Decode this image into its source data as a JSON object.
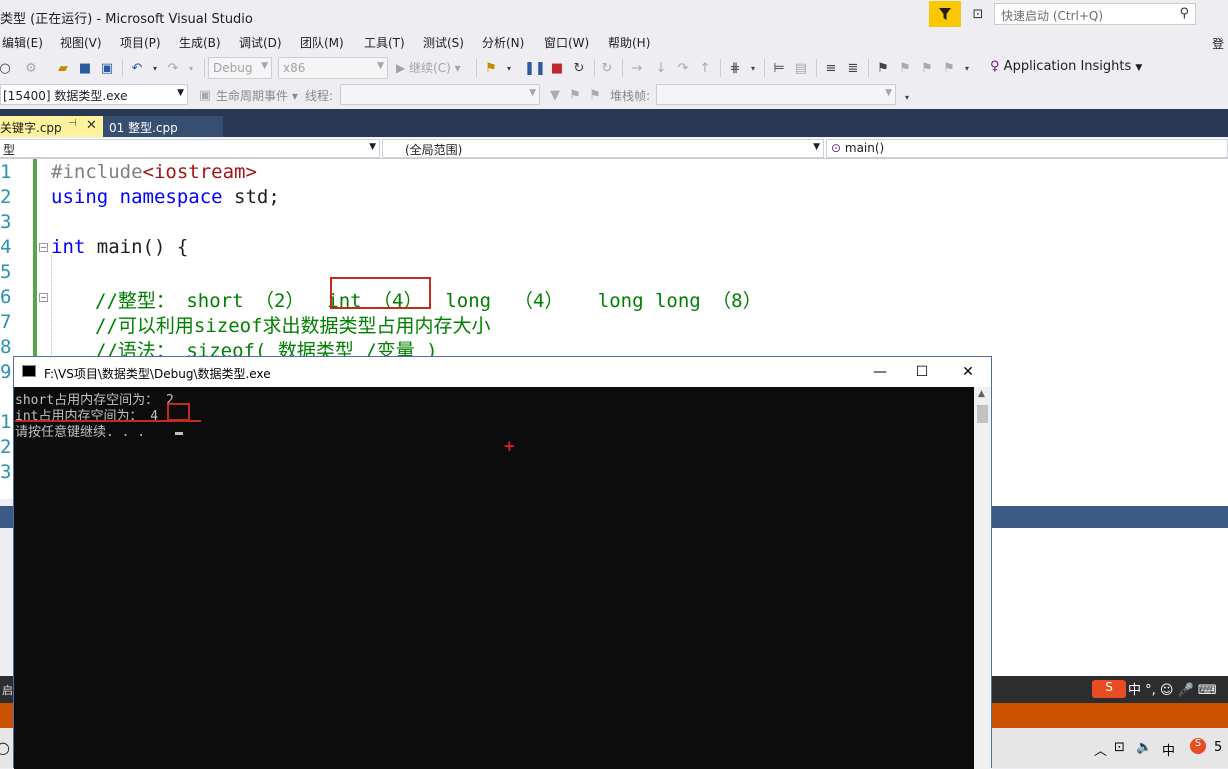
{
  "window": {
    "title": "类型 (正在运行) - Microsoft Visual Studio",
    "quick_launch_placeholder": "快速启动 (Ctrl+Q)",
    "signin_fragment": "登"
  },
  "menu": [
    "编辑(E)",
    "视图(V)",
    "项目(P)",
    "生成(B)",
    "调试(D)",
    "团队(M)",
    "工具(T)",
    "测试(S)",
    "分析(N)",
    "窗口(W)",
    "帮助(H)"
  ],
  "toolbar": {
    "config": "Debug",
    "platform": "x86",
    "continue_label": "继续(C)",
    "app_insights": "Application Insights"
  },
  "debug_toolbar": {
    "process": "[15400] 数据类型.exe",
    "lifecycle": "生命周期事件",
    "thread_label": "线程:",
    "stackframe_label": "堆栈帧:"
  },
  "tabs": {
    "active": "关键字.cpp",
    "inactive": "01 整型.cpp"
  },
  "navbar": {
    "project": "型",
    "scope": "(全局范围)",
    "member": "main()"
  },
  "editor": {
    "line_numbers": [
      "1",
      "2",
      "3",
      "4",
      "5",
      "6",
      "7",
      "8",
      "9",
      "1",
      "2",
      "3"
    ],
    "lines": [
      {
        "pp": "#include",
        "inc": "<iostream>"
      },
      {
        "kw1": "using",
        "kw2": "namespace",
        "rest": " std;"
      },
      {},
      {
        "kw": "int",
        "rest": " main() {"
      },
      {},
      {
        "c1": "//整型： short （2）  ",
        "c2": "int （4）",
        "c3": "  long  （4）   long long （8）"
      },
      {
        "cmt": "//可以利用sizeof求出数据类型占用内存大小"
      },
      {
        "cmt": "//语法： sizeof( 数据类型 /变量 )"
      }
    ]
  },
  "console": {
    "title": "F:\\VS项目\\数据类型\\Debug\\数据类型.exe",
    "lines": [
      "short占用内存空间为： 2",
      "int占用内存空间为： 4",
      "请按任意键继续. . ."
    ]
  },
  "taskbar": {
    "ime": "中",
    "clock_fragment": "5"
  },
  "colors": {
    "status_bar": "#ca5100",
    "tab_dark": "#293955",
    "highlight": "#c42b1c"
  }
}
